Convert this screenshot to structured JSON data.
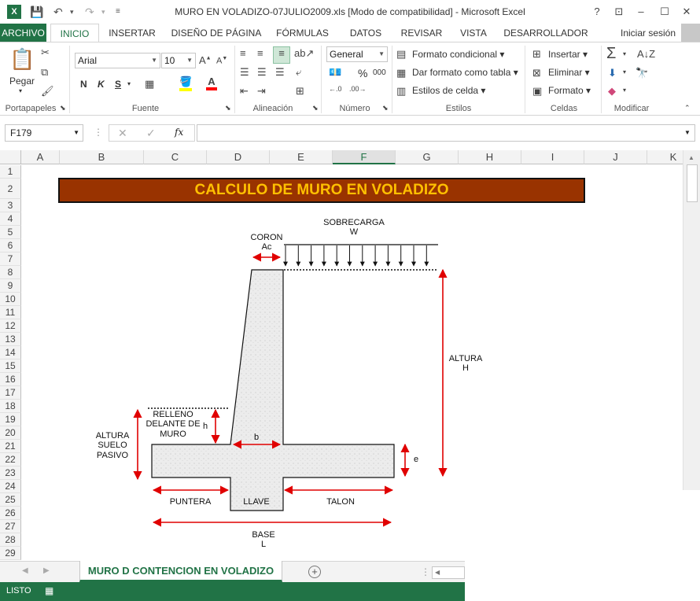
{
  "titlebar": {
    "title": "MURO EN VOLADIZO-07JULIO2009.xls  [Modo de compatibilidad] - Microsoft Excel",
    "help": "?",
    "ribbon_opts": "⊡",
    "minimize": "–",
    "maximize": "☐",
    "close": "✕"
  },
  "tabs": {
    "file": "ARCHIVO",
    "items": [
      "INICIO",
      "INSERTAR",
      "DISEÑO DE PÁGINA",
      "FÓRMULAS",
      "DATOS",
      "REVISAR",
      "VISTA",
      "DESARROLLADOR"
    ],
    "signin": "Iniciar sesión"
  },
  "ribbon": {
    "paste": "Pegar",
    "font_name": "Arial",
    "font_size": "10",
    "bold": "N",
    "italic": "K",
    "underline": "S",
    "number_format": "General",
    "percent": "%",
    "thousands": "000",
    "cond_format": "Formato condicional",
    "format_table": "Dar formato como tabla",
    "cell_styles": "Estilos de celda",
    "insert": "Insertar",
    "delete": "Eliminar",
    "format": "Formato",
    "groups": {
      "clipboard": "Portapapeles",
      "font": "Fuente",
      "alignment": "Alineación",
      "number": "Número",
      "styles": "Estilos",
      "cells": "Celdas",
      "editing": "Modificar"
    }
  },
  "formula_bar": {
    "name_box": "F179",
    "fx": "fx",
    "content": ""
  },
  "columns": [
    "A",
    "B",
    "C",
    "D",
    "E",
    "F",
    "G",
    "H",
    "I",
    "J",
    "K"
  ],
  "selected_column": "F",
  "rows": [
    "1",
    "2",
    "3",
    "4",
    "5",
    "6",
    "7",
    "8",
    "9",
    "10",
    "11",
    "12",
    "13",
    "14",
    "15",
    "16",
    "17",
    "18",
    "19",
    "20",
    "21",
    "22",
    "23",
    "24",
    "25",
    "26",
    "27",
    "28",
    "29"
  ],
  "sheet": {
    "banner": "CALCULO DE MURO EN VOLADIZO",
    "banner_bg": "#993300",
    "banner_fg": "#FFC000",
    "arrow_color": "#E00000",
    "labels": {
      "sobrecarga": "SOBRECARGA",
      "w": "W",
      "coron": "CORON",
      "ac": "Ac",
      "altura": "ALTURA",
      "h_cap": "H",
      "relleno_1": "RELLENO",
      "relleno_2": "DELANTE DE",
      "relleno_3": "MURO",
      "h_small": "h",
      "b": "b",
      "altura_suelo_1": "ALTURA",
      "altura_suelo_2": "SUELO",
      "altura_suelo_3": "PASIVO",
      "e": "e",
      "puntera": "PUNTERA",
      "llave": "LLAVE",
      "talon": "TALON",
      "base": "BASE",
      "l": "L"
    }
  },
  "sheet_tabs": {
    "active": "MURO D CONTENCION EN VOLADIZO",
    "add": "+"
  },
  "status": {
    "ready": "LISTO"
  }
}
